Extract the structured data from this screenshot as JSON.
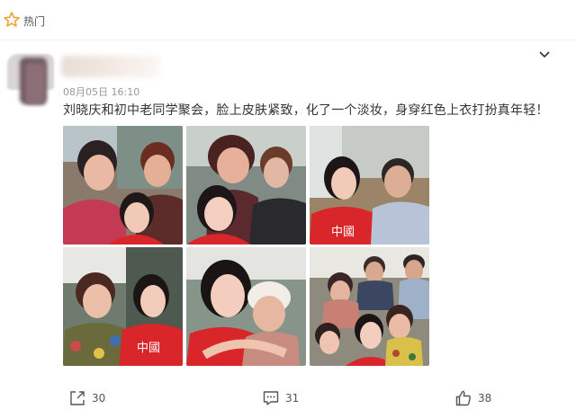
{
  "tab": {
    "label": "热门",
    "icon": "star-icon"
  },
  "post": {
    "date": "08月05日",
    "time": "16:10",
    "text": "刘晓庆和初中老同学聚会，脸上皮肤紧致，化了一个淡妆，身穿红色上衣打扮真年轻！",
    "more_icon": "chevron-down-icon"
  },
  "photos": [
    {
      "caption": ""
    },
    {
      "caption": ""
    },
    {
      "caption": "中國"
    },
    {
      "caption": "中國"
    },
    {
      "caption": ""
    },
    {
      "caption": ""
    }
  ],
  "actions": {
    "share": {
      "icon": "share-icon",
      "count": "30"
    },
    "comment": {
      "icon": "comment-icon",
      "count": "31"
    },
    "like": {
      "icon": "thumbs-up-icon",
      "count": "38"
    }
  },
  "colors": {
    "accent_red": "#d8262a",
    "star": "#f0a13a",
    "meta_gray": "#9a9a9a"
  }
}
